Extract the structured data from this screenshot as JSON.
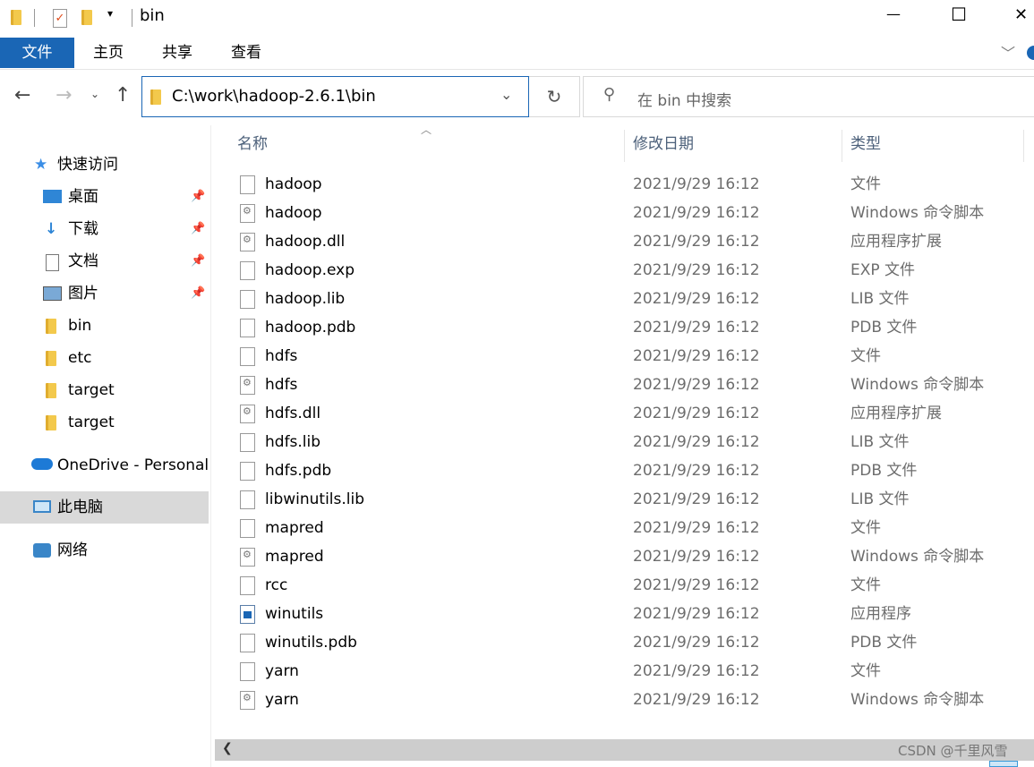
{
  "window": {
    "title": "bin",
    "controls": {
      "minimize": "—",
      "maximize": "☐",
      "close": "✕"
    }
  },
  "ribbon": {
    "tabs": [
      {
        "label": "文件",
        "active": true
      },
      {
        "label": "主页"
      },
      {
        "label": "共享"
      },
      {
        "label": "查看"
      }
    ]
  },
  "address": {
    "path": "C:\\work\\hadoop-2.6.1\\bin",
    "search_placeholder": "在 bin 中搜索"
  },
  "sidebar": {
    "items": [
      {
        "label": "快速访问",
        "icon": "star-icon"
      },
      {
        "label": "桌面",
        "icon": "desktop-icon",
        "pinned": true
      },
      {
        "label": "下载",
        "icon": "download-icon",
        "pinned": true
      },
      {
        "label": "文档",
        "icon": "document-icon",
        "pinned": true
      },
      {
        "label": "图片",
        "icon": "pictures-icon",
        "pinned": true
      },
      {
        "label": "bin",
        "icon": "folder-icon"
      },
      {
        "label": "etc",
        "icon": "folder-icon"
      },
      {
        "label": "target",
        "icon": "folder-icon"
      },
      {
        "label": "target",
        "icon": "folder-icon"
      },
      {
        "label": "OneDrive - Personal",
        "icon": "cloud-icon"
      },
      {
        "label": "此电脑",
        "icon": "computer-icon",
        "selected": true
      },
      {
        "label": "网络",
        "icon": "network-icon"
      }
    ]
  },
  "columns": [
    "名称",
    "修改日期",
    "类型"
  ],
  "files": [
    {
      "name": "hadoop",
      "date": "2021/9/29 16:12",
      "type": "文件",
      "icon": "file"
    },
    {
      "name": "hadoop",
      "date": "2021/9/29 16:12",
      "type": "Windows 命令脚本",
      "icon": "gear"
    },
    {
      "name": "hadoop.dll",
      "date": "2021/9/29 16:12",
      "type": "应用程序扩展",
      "icon": "gear"
    },
    {
      "name": "hadoop.exp",
      "date": "2021/9/29 16:12",
      "type": "EXP 文件",
      "icon": "file"
    },
    {
      "name": "hadoop.lib",
      "date": "2021/9/29 16:12",
      "type": "LIB 文件",
      "icon": "file"
    },
    {
      "name": "hadoop.pdb",
      "date": "2021/9/29 16:12",
      "type": "PDB 文件",
      "icon": "file"
    },
    {
      "name": "hdfs",
      "date": "2021/9/29 16:12",
      "type": "文件",
      "icon": "file"
    },
    {
      "name": "hdfs",
      "date": "2021/9/29 16:12",
      "type": "Windows 命令脚本",
      "icon": "gear"
    },
    {
      "name": "hdfs.dll",
      "date": "2021/9/29 16:12",
      "type": "应用程序扩展",
      "icon": "gear"
    },
    {
      "name": "hdfs.lib",
      "date": "2021/9/29 16:12",
      "type": "LIB 文件",
      "icon": "file"
    },
    {
      "name": "hdfs.pdb",
      "date": "2021/9/29 16:12",
      "type": "PDB 文件",
      "icon": "file"
    },
    {
      "name": "libwinutils.lib",
      "date": "2021/9/29 16:12",
      "type": "LIB 文件",
      "icon": "file"
    },
    {
      "name": "mapred",
      "date": "2021/9/29 16:12",
      "type": "文件",
      "icon": "file"
    },
    {
      "name": "mapred",
      "date": "2021/9/29 16:12",
      "type": "Windows 命令脚本",
      "icon": "gear"
    },
    {
      "name": "rcc",
      "date": "2021/9/29 16:12",
      "type": "文件",
      "icon": "file"
    },
    {
      "name": "winutils",
      "date": "2021/9/29 16:12",
      "type": "应用程序",
      "icon": "exe"
    },
    {
      "name": "winutils.pdb",
      "date": "2021/9/29 16:12",
      "type": "PDB 文件",
      "icon": "file"
    },
    {
      "name": "yarn",
      "date": "2021/9/29 16:12",
      "type": "文件",
      "icon": "file"
    },
    {
      "name": "yarn",
      "date": "2021/9/29 16:12",
      "type": "Windows 命令脚本",
      "icon": "gear"
    }
  ],
  "watermark": "CSDN @千里风雪"
}
